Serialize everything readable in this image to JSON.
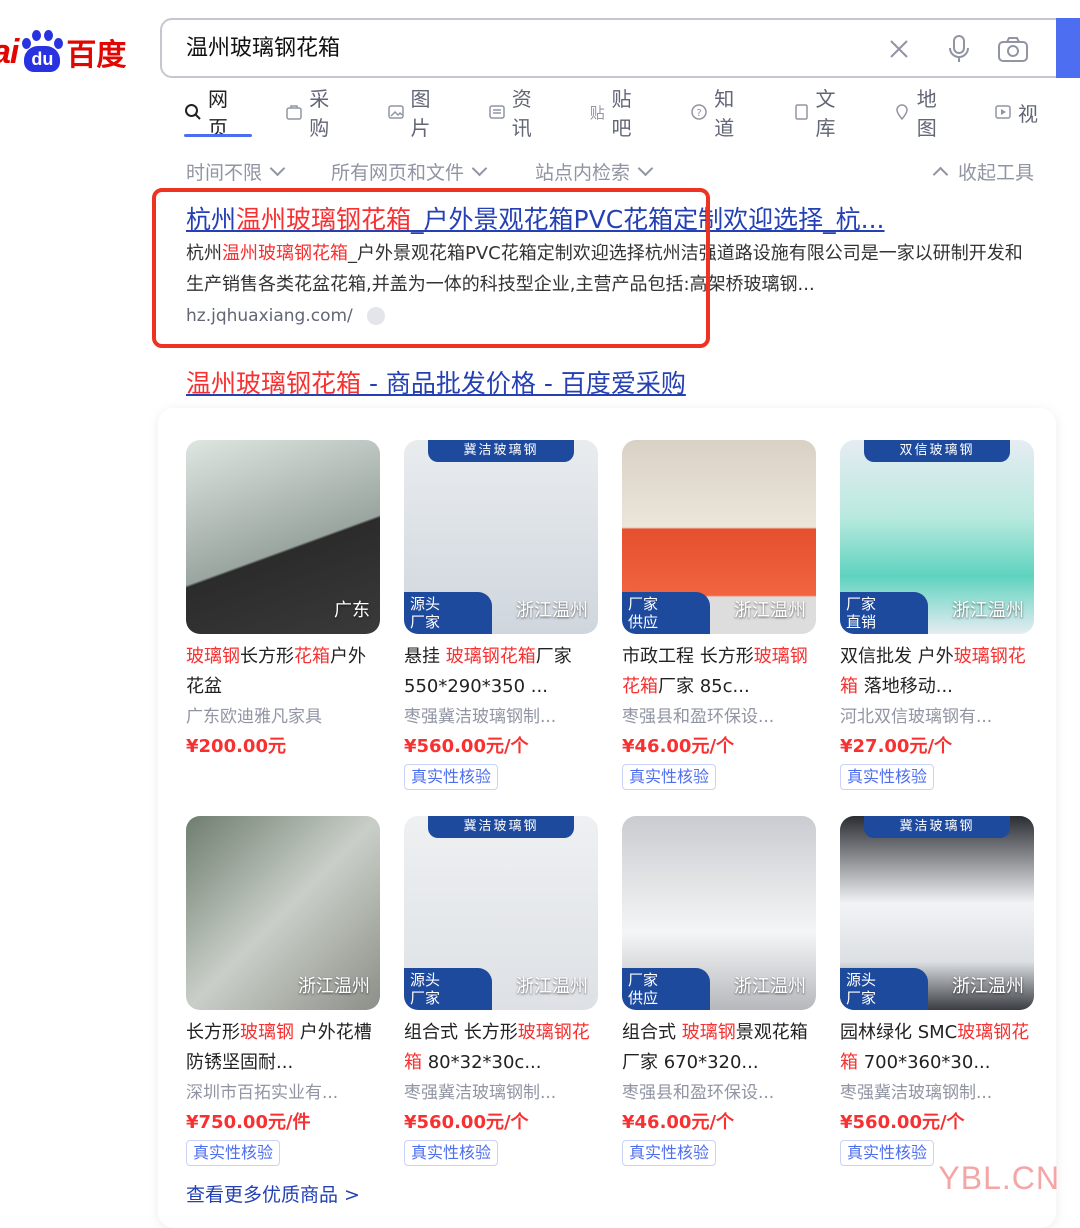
{
  "logo": {
    "text_a": "ai",
    "text_b": "du",
    "text_c": "百度"
  },
  "search": {
    "query": "温州玻璃钢花箱"
  },
  "tabs": [
    {
      "label": "网页",
      "icon": "search-icon"
    },
    {
      "label": "采购",
      "icon": "cart-icon"
    },
    {
      "label": "图片",
      "icon": "image-icon"
    },
    {
      "label": "资讯",
      "icon": "news-icon"
    },
    {
      "label": "贴吧",
      "icon": "tieba-icon"
    },
    {
      "label": "知道",
      "icon": "question-icon"
    },
    {
      "label": "文库",
      "icon": "doc-icon"
    },
    {
      "label": "地图",
      "icon": "map-icon"
    },
    {
      "label": "视",
      "icon": "video-icon"
    }
  ],
  "filters": {
    "time": "时间不限",
    "type": "所有网页和文件",
    "site": "站点内检索",
    "collapse": "收起工具"
  },
  "result1": {
    "title_a": "杭州",
    "title_em": "温州玻璃钢花箱",
    "title_b": "_户外景观花箱PVC花箱定制欢迎选择_杭...",
    "snippet_a": "杭州",
    "snippet_em": "温州玻璃钢花箱",
    "snippet_b": "_户外景观花箱PVC花箱定制欢迎选择杭州洁强道路设施有限公司是一家以研制开发和生产销售各类花盆花箱,并盖为一体的科技型企业,主营产品包括:高架桥玻璃钢...",
    "url": "hz.jqhuaxiang.com/"
  },
  "result2": {
    "title_em": "温州玻璃钢花箱",
    "title_b": " - 商品批发价格 - 百度爱采购"
  },
  "products": [
    {
      "tag": "广东",
      "band": "",
      "badge": "",
      "t_em1": "玻璃钢",
      "t_1": "长方形",
      "t_em2": "花箱",
      "t_2": "户外花盆",
      "shop": "广东欧迪雅凡家具",
      "price": "¥200.00元",
      "verify": ""
    },
    {
      "tag": "浙江温州",
      "band": "冀洁玻璃钢",
      "badge": "源头\n厂家",
      "t_em1": "",
      "t_1": "悬挂 ",
      "t_em2": "玻璃钢花箱",
      "t_2": "厂家 550*290*350 ...",
      "shop": "枣强冀洁玻璃钢制...",
      "price": "¥560.00元/个",
      "verify": "真实性核验"
    },
    {
      "tag": "浙江温州",
      "band": "",
      "badge": "厂家\n供应",
      "t_em1": "",
      "t_1": "市政工程 长方形",
      "t_em2": "玻璃钢花箱",
      "t_2": "厂家 85c...",
      "shop": "枣强县和盈环保设...",
      "price": "¥46.00元/个",
      "verify": "真实性核验"
    },
    {
      "tag": "浙江温州",
      "band": "双信玻璃钢",
      "badge": "厂家\n直销",
      "t_em1": "",
      "t_1": "双信批发 户外",
      "t_em2": "玻璃钢花箱",
      "t_2": " 落地移动...",
      "shop": "河北双信玻璃钢有...",
      "price": "¥27.00元/个",
      "verify": "真实性核验"
    },
    {
      "tag": "浙江温州",
      "band": "",
      "badge": "",
      "t_em1": "",
      "t_1": "长方形",
      "t_em2": "玻璃钢",
      "t_2": " 户外花槽 防锈坚固耐...",
      "shop": "深圳市百拓实业有...",
      "price": "¥750.00元/件",
      "verify": "真实性核验"
    },
    {
      "tag": "浙江温州",
      "band": "冀洁玻璃钢",
      "badge": "源头\n厂家",
      "t_em1": "",
      "t_1": "组合式 长方形",
      "t_em2": "玻璃钢花箱",
      "t_2": " 80*32*30c...",
      "shop": "枣强冀洁玻璃钢制...",
      "price": "¥560.00元/个",
      "verify": "真实性核验"
    },
    {
      "tag": "浙江温州",
      "band": "",
      "badge": "厂家\n供应",
      "t_em1": "",
      "t_1": "组合式 ",
      "t_em2": "玻璃钢",
      "t_2": "景观花箱厂家 670*320...",
      "shop": "枣强县和盈环保设...",
      "price": "¥46.00元/个",
      "verify": "真实性核验"
    },
    {
      "tag": "浙江温州",
      "band": "冀洁玻璃钢",
      "badge": "源头\n厂家",
      "t_em1": "",
      "t_1": "园林绿化 SMC",
      "t_em2": "玻璃钢花箱",
      "t_2": " 700*360*30...",
      "shop": "枣强冀洁玻璃钢制...",
      "price": "¥560.00元/个",
      "verify": "真实性核验"
    }
  ],
  "more_link": "查看更多优质商品 >",
  "watermark": "YBL.CN",
  "colors": {
    "link": "#2440b3",
    "highlight": "#f73131",
    "brand_blue": "#4e6ef2",
    "box_red": "#ee3322"
  }
}
